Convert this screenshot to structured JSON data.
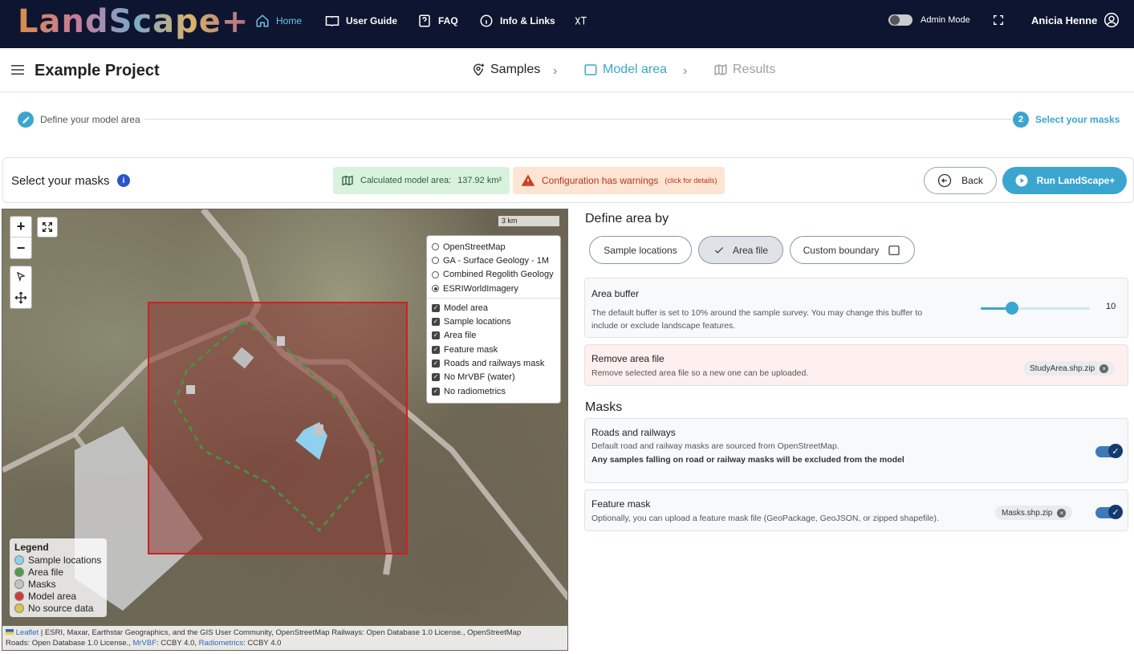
{
  "app": {
    "logo_text": "LandScape+"
  },
  "nav": {
    "home": "Home",
    "user_guide": "User Guide",
    "faq": "FAQ",
    "info_links": "Info & Links",
    "admin_mode": "Admin Mode",
    "user_name": "Anicia Henne"
  },
  "project": {
    "title": "Example Project"
  },
  "breadcrumb": {
    "samples": "Samples",
    "model_area": "Model area",
    "results": "Results"
  },
  "stepper": {
    "step1_label": "Define your model area",
    "step2_num": "2",
    "step2_label": "Select your masks"
  },
  "toolbar": {
    "title": "Select your masks",
    "calc_label": "Calculated model area:",
    "calc_value": "137.92 km²",
    "warning": "Configuration has warnings",
    "warning_hint": "(click for details)",
    "back": "Back",
    "run": "Run LandScape+"
  },
  "map": {
    "scale_label": "3 km",
    "base_layers": [
      {
        "label": "OpenStreetMap",
        "selected": false
      },
      {
        "label": "GA - Surface Geology - 1M",
        "selected": false
      },
      {
        "label": "Combined Regolith Geology",
        "selected": false
      },
      {
        "label": "ESRIWorldImagery",
        "selected": true
      }
    ],
    "overlays": [
      {
        "label": "Model area",
        "checked": true
      },
      {
        "label": "Sample locations",
        "checked": true
      },
      {
        "label": "Area file",
        "checked": true
      },
      {
        "label": "Feature mask",
        "checked": true
      },
      {
        "label": "Roads and railways mask",
        "checked": true
      },
      {
        "label": "No MrVBF (water)",
        "checked": true
      },
      {
        "label": "No radiometrics",
        "checked": true
      }
    ],
    "legend": {
      "title": "Legend",
      "items": [
        {
          "label": "Sample locations",
          "color": "#8fd0ee"
        },
        {
          "label": "Area file",
          "color": "#4f9a4f"
        },
        {
          "label": "Masks",
          "color": "#c4c4c4"
        },
        {
          "label": "Model area",
          "color": "#d23a3a"
        },
        {
          "label": "No source data",
          "color": "#d6c64a"
        }
      ]
    },
    "attribution": {
      "leaflet": "Leaflet",
      "line1": " | ESRI, Maxar, Earthstar Geographics, and the GIS User Community, OpenStreetMap Railways: Open Database 1.0 License., OpenStreetMap",
      "line2_prefix": "Roads: Open Database 1.0 License., ",
      "mrvbf": "MrVBF",
      "mrvbf_lic": ": CCBY 4.0, ",
      "radiometrics": "Radiometrics",
      "radiometrics_lic": ": CCBY 4.0"
    }
  },
  "panel": {
    "define_title": "Define area by",
    "seg_sample": "Sample locations",
    "seg_area": "Area file",
    "seg_custom": "Custom boundary",
    "buffer": {
      "title": "Area buffer",
      "desc1": "The default buffer is set to 10% around the sample survey. You may change this buffer to",
      "desc2": "include or exclude landscape features.",
      "value": "10",
      "fill_fraction": 0.29
    },
    "remove": {
      "title": "Remove area file",
      "desc": "Remove selected area file so a new one can be uploaded.",
      "file": "StudyArea.shp.zip"
    },
    "masks_title": "Masks",
    "roads": {
      "title": "Roads and railways",
      "desc": "Default road and railway masks are sourced from OpenStreetMap.",
      "note": "Any samples falling on road or railway masks will be excluded from the model",
      "enabled": true
    },
    "feature": {
      "title": "Feature mask",
      "desc": "Optionally, you can upload a feature mask file (GeoPackage, GeoJSON, or zipped shapefile).",
      "file": "Masks.shp.zip",
      "enabled": true
    }
  },
  "colors": {
    "accent": "#3aa6cf",
    "nav_bg": "#0e1530",
    "warning": "#b4361c",
    "model_area": "#d23a3a"
  }
}
